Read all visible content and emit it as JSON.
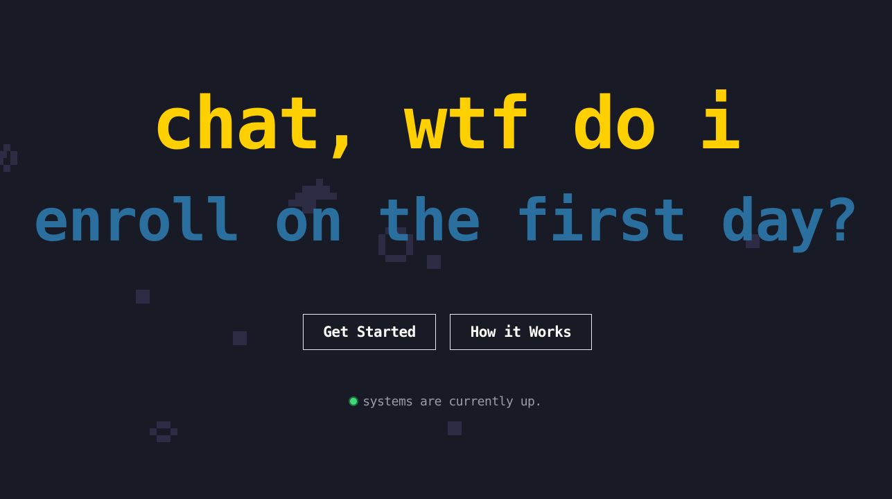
{
  "hero": {
    "headline_line1": "chat, wtf do i",
    "headline_line2": "enroll on the first day?"
  },
  "actions": {
    "get_started_label": "Get Started",
    "how_it_works_label": "How it Works"
  },
  "status": {
    "text": "systems are currently up.",
    "state": "up"
  },
  "colors": {
    "background": "#181a26",
    "primary": "#ffd000",
    "secondary": "#2a6f9e",
    "status_ok": "#3fd97c",
    "pixel_decor": "#2e2b45"
  },
  "icons": {
    "status_indicator": "status-dot-icon"
  }
}
